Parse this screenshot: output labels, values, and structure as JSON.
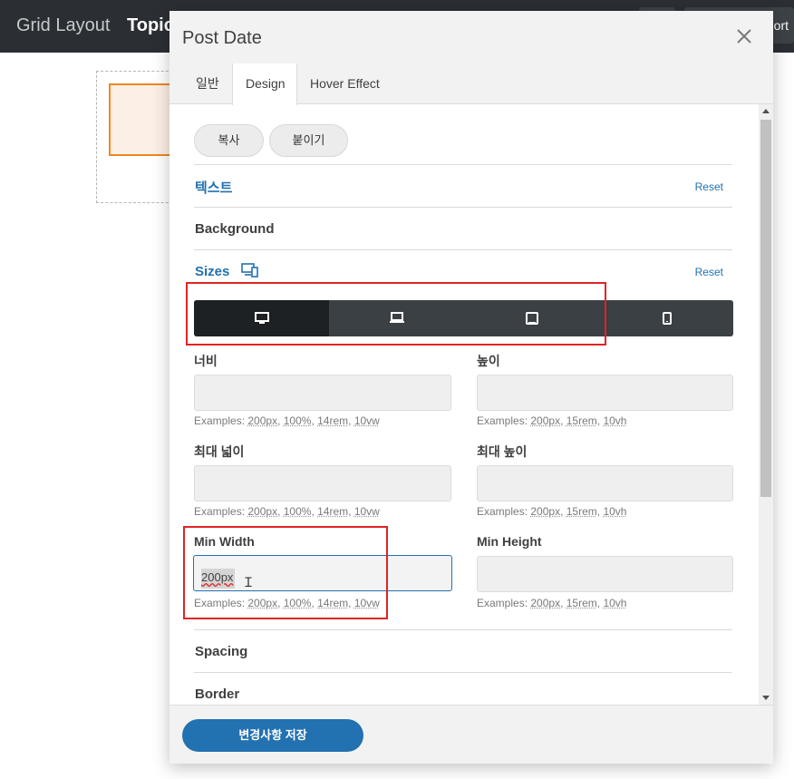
{
  "app": {
    "title": "Grid Layout",
    "subtitle": "Topic",
    "right_button_label": "ort"
  },
  "modal": {
    "title": "Post Date",
    "tabs": [
      {
        "label": "일반",
        "active": false
      },
      {
        "label": "Design",
        "active": true
      },
      {
        "label": "Hover Effect",
        "active": false
      }
    ],
    "copy_label": "복사",
    "paste_label": "붙이기",
    "sections": {
      "text": {
        "title": "텍스트",
        "reset": "Reset"
      },
      "background": {
        "title": "Background"
      },
      "sizes": {
        "title": "Sizes",
        "reset": "Reset"
      },
      "spacing": {
        "title": "Spacing"
      },
      "border": {
        "title": "Border"
      }
    },
    "devices": [
      {
        "name": "desktop",
        "active": true
      },
      {
        "name": "laptop",
        "active": false
      },
      {
        "name": "tablet",
        "active": false
      },
      {
        "name": "mobile",
        "active": false
      }
    ],
    "fields": {
      "width": {
        "label": "너비",
        "value": "",
        "hint_prefix": "Examples:",
        "hints": [
          "200px",
          "100%",
          "14rem",
          "10vw"
        ]
      },
      "height": {
        "label": "높이",
        "value": "",
        "hint_prefix": "Examples:",
        "hints": [
          "200px",
          "15rem",
          "10vh"
        ]
      },
      "max_width": {
        "label": "최대 넓이",
        "value": "",
        "hint_prefix": "Examples:",
        "hints": [
          "200px",
          "100%",
          "14rem",
          "10vw"
        ]
      },
      "max_height": {
        "label": "최대 높이",
        "value": "",
        "hint_prefix": "Examples:",
        "hints": [
          "200px",
          "15rem",
          "10vh"
        ]
      },
      "min_width": {
        "label": "Min Width",
        "value": "200px",
        "hint_prefix": "Examples:",
        "hints": [
          "200px",
          "100%",
          "14rem",
          "10vw"
        ]
      },
      "min_height": {
        "label": "Min Height",
        "value": "",
        "hint_prefix": "Examples:",
        "hints": [
          "200px",
          "15rem",
          "10vh"
        ]
      }
    },
    "save_label": "변경사항 저장"
  },
  "colors": {
    "accent": "#2271b1",
    "highlight": "#e02424",
    "module_border": "#f0861f"
  }
}
